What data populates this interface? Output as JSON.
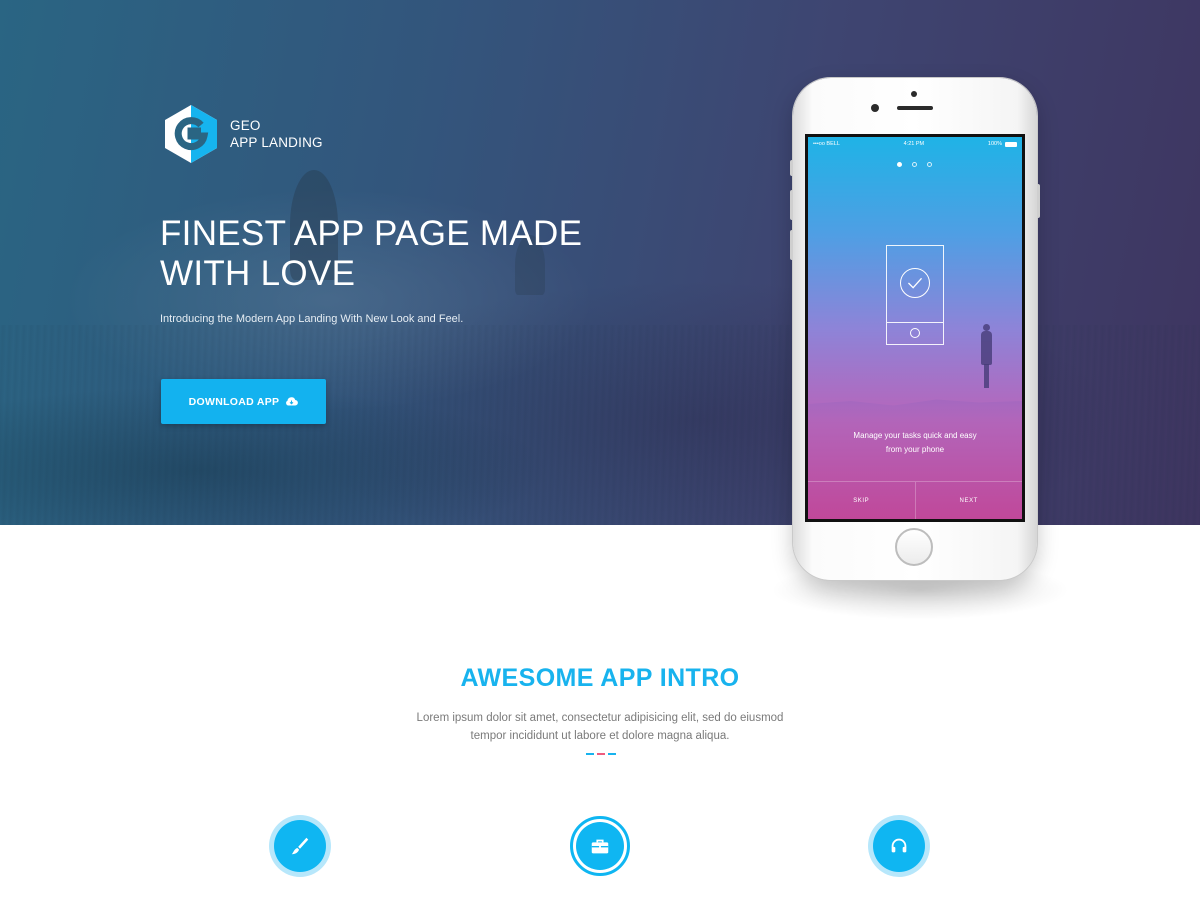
{
  "hero": {
    "logo": {
      "line1": "GEO",
      "line2": "APP LANDING"
    },
    "headline_line1": "FINEST APP PAGE MADE",
    "headline_line2": "WITH LOVE",
    "subline": "Introducing the Modern App Landing With New Look and Feel.",
    "download_label": "DOWNLOAD APP",
    "download_icon": "cloud-download-icon"
  },
  "phone": {
    "status": {
      "carrier": "•••oo BELL",
      "time": "4:21 PM",
      "battery": "100%"
    },
    "caption_line1": "Manage your tasks quick and easy",
    "caption_line2": "from your phone",
    "skip_label": "SKIP",
    "next_label": "NEXT",
    "active_dot": 1,
    "dot_count": 3
  },
  "intro": {
    "title": "AWESOME APP INTRO",
    "text_line1": "Lorem ipsum dolor sit amet, consectetur adipisicing elit, sed do eiusmod",
    "text_line2": "tempor incididunt ut labore et dolore magna aliqua.",
    "divider_colors": [
      "#18b3ee",
      "#ef5b7e",
      "#18b3ee"
    ]
  },
  "features": [
    {
      "icon": "brush-icon"
    },
    {
      "icon": "briefcase-icon"
    },
    {
      "icon": "headphones-icon"
    }
  ],
  "colors": {
    "accent": "#13b2ef",
    "hero_start": "#2a6583",
    "hero_end": "#3e3560"
  }
}
